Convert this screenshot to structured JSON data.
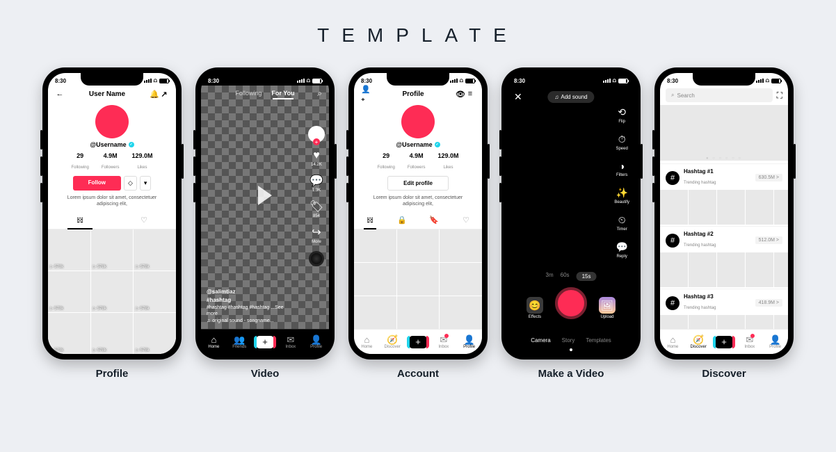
{
  "page_title": "TEMPLATE",
  "captions": [
    "Profile",
    "Video",
    "Account",
    "Make a Video",
    "Discover"
  ],
  "status_time": "8:30",
  "profile": {
    "title": "User Name",
    "username": "@Username",
    "stats": [
      {
        "val": "29",
        "label": "Following"
      },
      {
        "val": "4.9M",
        "label": "Followers"
      },
      {
        "val": "129.0M",
        "label": "Likes"
      }
    ],
    "follow_btn": "Follow",
    "bio": "Lorem ipsum dolor sit amet, consectetuer adipiscing elit,",
    "views": "578k"
  },
  "nav": {
    "home": "Home",
    "discover": "Discover",
    "friends": "Friends",
    "inbox": "Inbox",
    "profile": "Profile"
  },
  "video": {
    "tabs": {
      "following": "Following",
      "foryou": "For You"
    },
    "likes": "14.2K",
    "comments": "1.3K",
    "saves": "854",
    "shares": "More",
    "handle": "@salimtiaz",
    "hashtag_bold": "#hashtag",
    "hashtags": "#hashtag #hashtag #hashtag ...See more",
    "sound": "original sound - songname..."
  },
  "account": {
    "title": "Profile",
    "edit_btn": "Edit profile"
  },
  "camera": {
    "add_sound": "Add sound",
    "tools": [
      "Flip",
      "Speed",
      "Filters",
      "Beautify",
      "Timer",
      "Reply"
    ],
    "durations": [
      "3m",
      "60s",
      "15s"
    ],
    "effects": "Effects",
    "upload": "Upload",
    "modes": [
      "Camera",
      "Story",
      "Templates"
    ]
  },
  "discover": {
    "search_placeholder": "Search",
    "trending": "Trending hashtag",
    "tags": [
      {
        "name": "Hashtag #1",
        "count": "630.5M >"
      },
      {
        "name": "Hashtag #2",
        "count": "512.0M >"
      },
      {
        "name": "Hashtag #3",
        "count": "418.9M >"
      }
    ]
  }
}
